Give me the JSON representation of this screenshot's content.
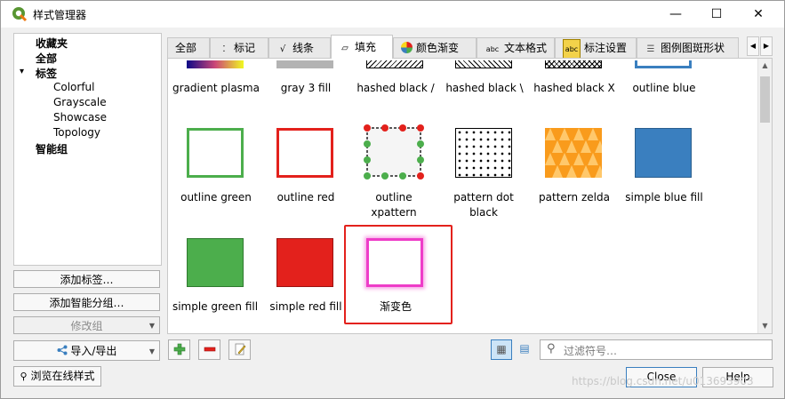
{
  "window": {
    "title": "样式管理器",
    "minimize": "—",
    "maximize": "☐",
    "close": "✕"
  },
  "tree": {
    "items": [
      {
        "label": "收藏夹",
        "bold": true
      },
      {
        "label": "全部",
        "bold": true
      },
      {
        "label": "标签",
        "bold": true,
        "expand": "▾"
      },
      {
        "label": "Colorful"
      },
      {
        "label": "Grayscale"
      },
      {
        "label": "Showcase"
      },
      {
        "label": "Topology"
      },
      {
        "label": "智能组",
        "bold": true
      }
    ]
  },
  "left_buttons": {
    "add_tag": "添加标签…",
    "add_smart_group": "添加智能分组…",
    "modify_group": "修改组",
    "import_export": "导入/导出",
    "browse_online": "浏览在线样式"
  },
  "tabs": [
    {
      "label": "全部"
    },
    {
      "label": "标记",
      "icon": "marker-icon"
    },
    {
      "label": "线条",
      "icon": "line-icon"
    },
    {
      "label": "填充",
      "icon": "fill-icon",
      "active": true
    },
    {
      "label": "颜色渐变",
      "icon": "color-ramp-icon"
    },
    {
      "label": "文本格式",
      "icon": "text-format-icon"
    },
    {
      "label": "标注设置",
      "icon": "label-settings-icon"
    },
    {
      "label": "图例图斑形状",
      "icon": "legend-patch-icon"
    }
  ],
  "tab_nav": {
    "prev": "◀",
    "next": "▶"
  },
  "symbols": {
    "row1": [
      "gradient plasma",
      "gray 3 fill",
      "hashed black /",
      "hashed black \\",
      "hashed black X",
      "outline blue"
    ],
    "row2": [
      "outline green",
      "outline red",
      "outline xpattern",
      "pattern dot black",
      "pattern zelda",
      "simple blue fill"
    ],
    "row3": [
      "simple green fill",
      "simple red fill",
      "渐变色"
    ]
  },
  "search": {
    "placeholder": "过滤符号…"
  },
  "dialog_buttons": {
    "close": "Close",
    "help": "Help"
  },
  "watermark": "https://blog.csdn.net/u013693903",
  "colors": {
    "outline_green": "#4cae4c",
    "outline_red": "#e3211c",
    "simple_blue": "#3a7fbf",
    "simple_green": "#4cae4c",
    "simple_red": "#e3211c",
    "gradient_magenta": "#ee3cc8",
    "zelda_orange": "#f99b1c"
  }
}
